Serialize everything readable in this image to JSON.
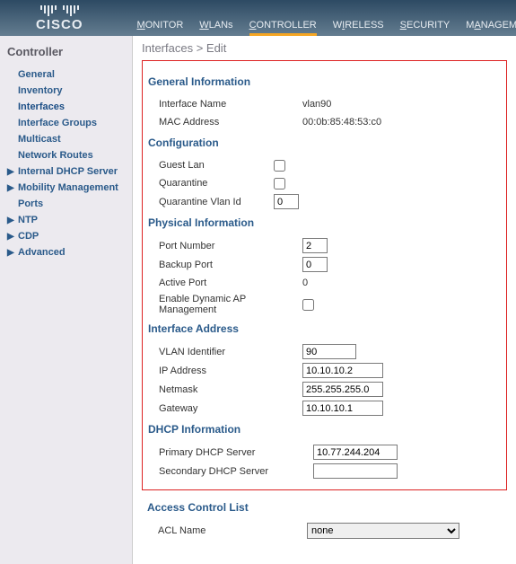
{
  "nav": {
    "monitor": "MONITOR",
    "wlans": "WLANs",
    "controller": "CONTROLLER",
    "wireless": "WIRELESS",
    "security": "SECURITY",
    "management": "MANAGEMENT"
  },
  "logo_text": "CISCO",
  "sidebar": {
    "title": "Controller",
    "items": {
      "general": "General",
      "inventory": "Inventory",
      "interfaces": "Interfaces",
      "interface_groups": "Interface Groups",
      "multicast": "Multicast",
      "network_routes": "Network Routes",
      "internal_dhcp": "Internal DHCP Server",
      "mobility": "Mobility Management",
      "ports": "Ports",
      "ntp": "NTP",
      "cdp": "CDP",
      "advanced": "Advanced"
    }
  },
  "breadcrumb": "Interfaces > Edit",
  "sections": {
    "gen_info": "General Information",
    "config": "Configuration",
    "phys": "Physical Information",
    "iface_addr": "Interface Address",
    "dhcp": "DHCP Information",
    "acl": "Access Control List"
  },
  "general_info": {
    "interface_name_label": "Interface Name",
    "interface_name_value": "vlan90",
    "mac_label": "MAC Address",
    "mac_value": "00:0b:85:48:53:c0"
  },
  "config": {
    "guest_lan_label": "Guest Lan",
    "quarantine_label": "Quarantine",
    "quarantine_vlan_label": "Quarantine Vlan Id",
    "quarantine_vlan_value": "0"
  },
  "phys": {
    "port_label": "Port Number",
    "port_value": "2",
    "backup_label": "Backup Port",
    "backup_value": "0",
    "active_label": "Active Port",
    "active_value": "0",
    "dyn_ap_label": "Enable Dynamic AP Management"
  },
  "iface_addr": {
    "vlan_label": "VLAN Identifier",
    "vlan_value": "90",
    "ip_label": "IP Address",
    "ip_value": "10.10.10.2",
    "mask_label": "Netmask",
    "mask_value": "255.255.255.0",
    "gw_label": "Gateway",
    "gw_value": "10.10.10.1"
  },
  "dhcp": {
    "primary_label": "Primary DHCP Server",
    "primary_value": "10.77.244.204",
    "secondary_label": "Secondary DHCP Server",
    "secondary_value": ""
  },
  "acl": {
    "name_label": "ACL Name",
    "selected": "none"
  }
}
